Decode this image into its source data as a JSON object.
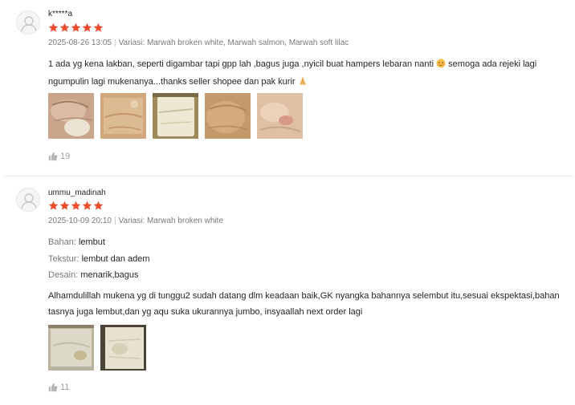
{
  "colors": {
    "star": "#ee4d2d",
    "like": "#999999"
  },
  "reviews": [
    {
      "username": "k*****a",
      "rating": 5,
      "date": "2025-08-26 13:05",
      "variant": "Variasi: Marwah broken white, Marwah salmon, Marwah soft lilac",
      "text_part1": "1 ada yg kena lakban, seperti digambar tapi gpp lah ,bagus juga ,nyicil buat hampers lebaran nanti",
      "text_part2": "semoga ada rejeki lagi ngumpulin lagi mukenanya...thanks seller shopee dan pak kurir",
      "emoji1": "blushing-face",
      "emoji2": "folded-hands",
      "photos": 5,
      "likes": "19"
    },
    {
      "username": "ummu_madinah",
      "rating": 5,
      "date": "2025-10-09 20:10",
      "variant": "Variasi: Marwah broken white",
      "attributes": [
        {
          "key": "Bahan:",
          "value": "lembut"
        },
        {
          "key": "Tekstur:",
          "value": "lembut dan adem"
        },
        {
          "key": "Desain:",
          "value": "menarik,bagus"
        }
      ],
      "text": "Alhamdulillah mukena yg di tunggu2 sudah datang dlm keadaan baik,GK nyangka bahannya selembut itu,sesuai ekspektasi,bahan tasnya juga lembut,dan yg aqu suka ukurannya jumbo, insyaallah next order lagi",
      "photos": 2,
      "likes": "11"
    }
  ]
}
